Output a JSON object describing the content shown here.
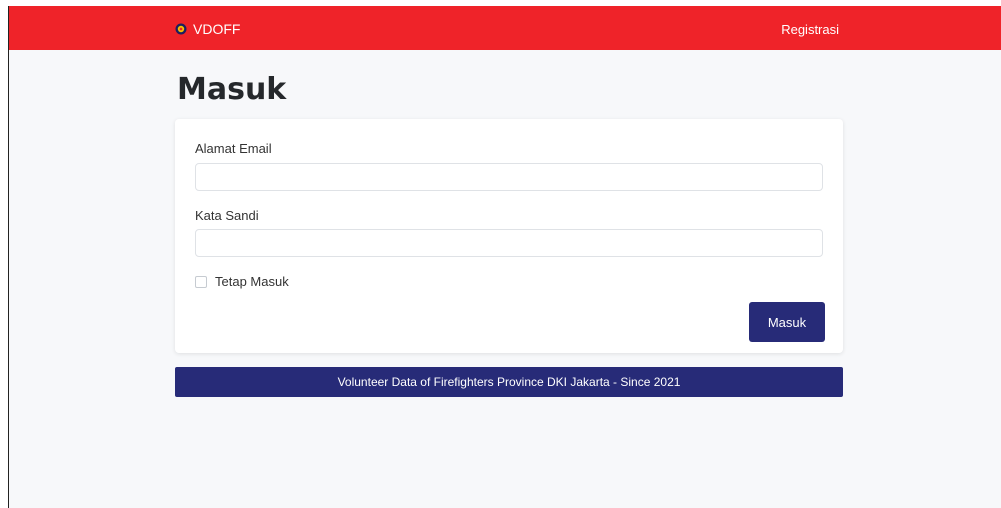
{
  "navbar": {
    "brand": "VDOFF",
    "logo_icon": "fire-emblem-icon",
    "register_link": "Registrasi",
    "bg_color": "#ef2329"
  },
  "page": {
    "title": "Masuk"
  },
  "login_form": {
    "email_label": "Alamat Email",
    "email_value": "",
    "email_placeholder": "",
    "password_label": "Kata Sandi",
    "password_value": "",
    "password_placeholder": "",
    "remember_label": "Tetap Masuk",
    "remember_checked": false,
    "submit_label": "Masuk",
    "accent_color": "#272b78"
  },
  "footer": {
    "text": "Volunteer Data of Firefighters Province DKI Jakarta - Since 2021"
  }
}
